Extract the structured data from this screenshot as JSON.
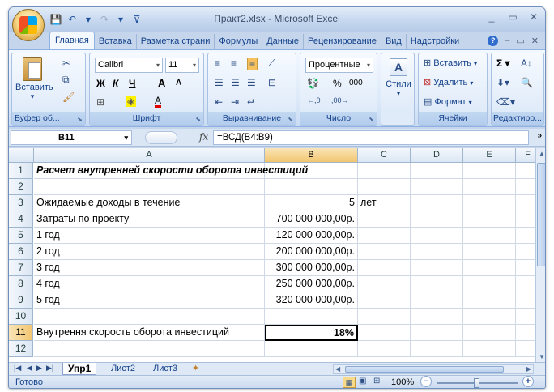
{
  "window": {
    "title": "Практ2.xlsx - Microsoft Excel",
    "controls": [
      "_",
      "▭",
      "✕"
    ]
  },
  "tabs": [
    "Главная",
    "Вставка",
    "Разметка страни",
    "Формулы",
    "Данные",
    "Рецензирование",
    "Вид",
    "Надстройки"
  ],
  "ribbon": {
    "clipboard": {
      "paste": "Вставить",
      "label": "Буфер об..."
    },
    "font": {
      "name": "Calibri",
      "size": "11",
      "bold": "Ж",
      "italic": "К",
      "underline": "Ч",
      "grow": "A",
      "shrink": "A",
      "label": "Шрифт"
    },
    "alignment": {
      "label": "Выравнивание"
    },
    "number": {
      "format": "Процентные",
      "percent": "%",
      "thousands": "000",
      "label": "Число"
    },
    "styles": {
      "label": "Стили"
    },
    "cells": {
      "insert": "Вставить",
      "delete": "Удалить",
      "format": "Формат",
      "label": "Ячейки"
    },
    "editing": {
      "label": "Редактиро..."
    }
  },
  "formula_bar": {
    "name_box": "B11",
    "fx": "fx",
    "formula": "=ВСД(B4:B9)"
  },
  "sheet": {
    "columns": [
      "A",
      "B",
      "C",
      "D",
      "E",
      "F"
    ],
    "rows": [
      {
        "n": "1",
        "a": "Расчет внутренней скорости оборота инвестиций",
        "b": "",
        "c": ""
      },
      {
        "n": "2",
        "a": "",
        "b": "",
        "c": ""
      },
      {
        "n": "3",
        "a": "Ожидаемые доходы в течение",
        "b": "5",
        "c": "лет"
      },
      {
        "n": "4",
        "a": "Затраты по проекту",
        "b": "-700 000 000,00р.",
        "c": ""
      },
      {
        "n": "5",
        "a": "1 год",
        "b": "120 000 000,00р.",
        "c": ""
      },
      {
        "n": "6",
        "a": "2 год",
        "b": "200 000 000,00р.",
        "c": ""
      },
      {
        "n": "7",
        "a": "3 год",
        "b": "300 000 000,00р.",
        "c": ""
      },
      {
        "n": "8",
        "a": "4 год",
        "b": "250 000 000,00р.",
        "c": ""
      },
      {
        "n": "9",
        "a": "5 год",
        "b": "320 000 000,00р.",
        "c": ""
      },
      {
        "n": "10",
        "a": "",
        "b": "",
        "c": ""
      },
      {
        "n": "11",
        "a": "Внутрення скорость оборота инвестиций",
        "b": "18%",
        "c": ""
      },
      {
        "n": "12",
        "a": "",
        "b": "",
        "c": ""
      }
    ]
  },
  "sheet_tabs": [
    "Упр1",
    "Лист2",
    "Лист3"
  ],
  "status": {
    "ready": "Готово",
    "zoom": "100%"
  }
}
